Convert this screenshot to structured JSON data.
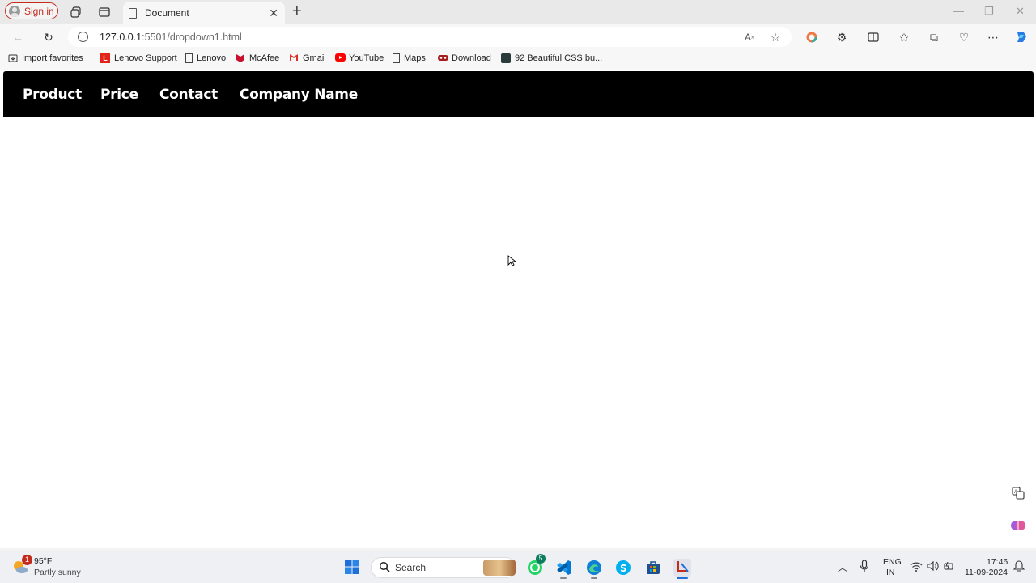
{
  "browser": {
    "sign_in_label": "Sign in",
    "tab_title": "Document",
    "url_host": "127.0.0.1",
    "url_path": ":5501/dropdown1.html"
  },
  "favorites": [
    {
      "label": "Import favorites",
      "icon": "import-icon"
    },
    {
      "label": "Lenovo Support",
      "icon": "lenovo-support-icon"
    },
    {
      "label": "Lenovo",
      "icon": "page-icon"
    },
    {
      "label": "McAfee",
      "icon": "mcafee-icon"
    },
    {
      "label": "Gmail",
      "icon": "gmail-icon"
    },
    {
      "label": "YouTube",
      "icon": "youtube-icon"
    },
    {
      "label": "Maps",
      "icon": "page-icon"
    },
    {
      "label": "Download",
      "icon": "download-icon"
    },
    {
      "label": "92 Beautiful CSS bu...",
      "icon": "css-icon"
    }
  ],
  "site_nav": {
    "items": [
      "Product",
      "Price",
      "Contact",
      "Company Name"
    ]
  },
  "taskbar": {
    "weather_temp": "95°F",
    "weather_desc": "Partly sunny",
    "weather_badge": "1",
    "search_label": "Search",
    "whatsapp_badge": "5",
    "lang_top": "ENG",
    "lang_bottom": "IN",
    "time": "17:46",
    "date": "11-09-2024"
  },
  "colors": {
    "site_header_bg": "#000000",
    "site_header_text": "#ffffff",
    "sign_in_accent": "#c42b1c"
  }
}
